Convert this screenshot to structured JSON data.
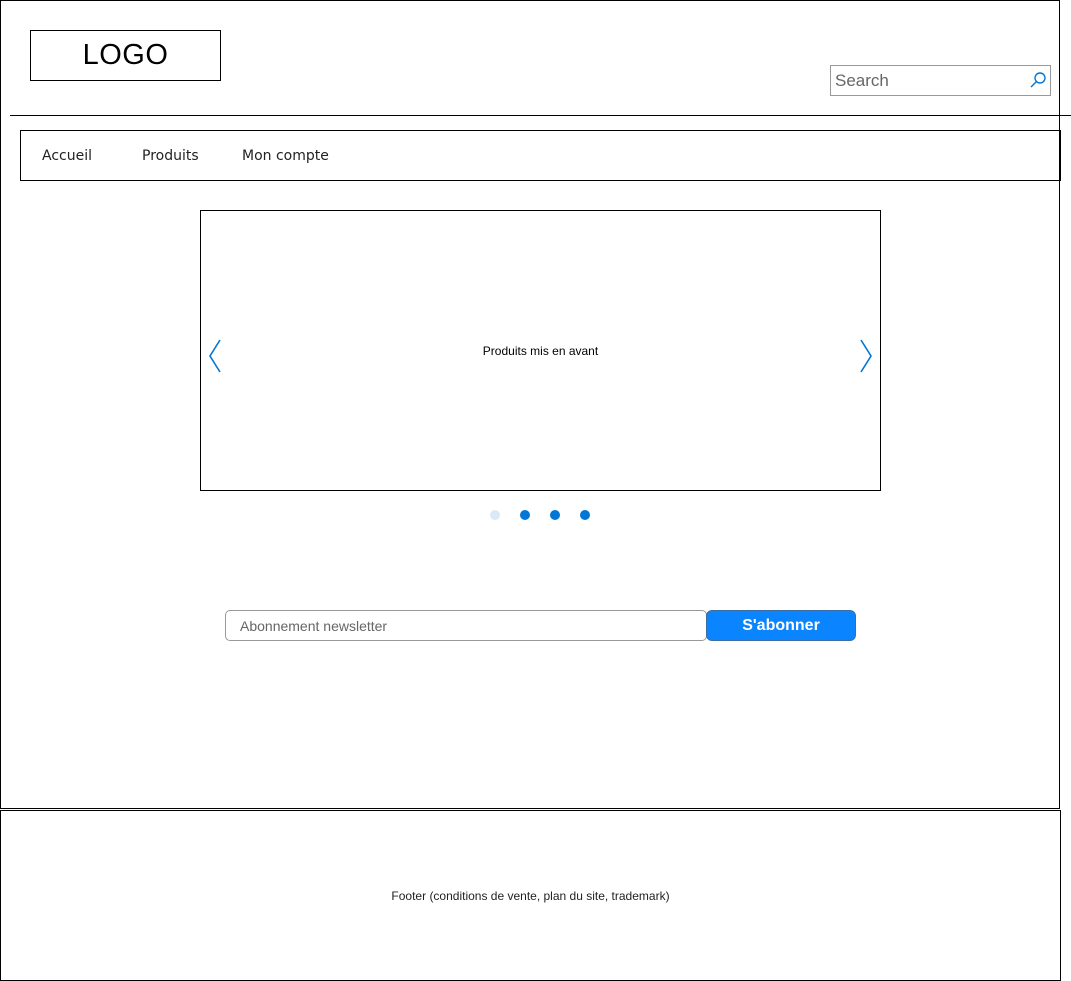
{
  "header": {
    "logo_text": "LOGO",
    "search_placeholder": "Search"
  },
  "nav": {
    "items": [
      {
        "label": "Accueil"
      },
      {
        "label": "Produits"
      },
      {
        "label": "Mon compte"
      }
    ]
  },
  "carousel": {
    "caption": "Produits mis en avant",
    "prev_icon": "chevron-left-icon",
    "next_icon": "chevron-right-icon",
    "slide_count": 4,
    "active_index": 0
  },
  "newsletter": {
    "placeholder": "Abonnement newsletter",
    "button_label": "S'abonner"
  },
  "footer": {
    "text": "Footer (conditions de vente, plan du site, trademark)"
  },
  "colors": {
    "accent": "#0a84ff",
    "icon_blue": "#0077d6",
    "dot_active": "#dbe9f7",
    "dot_inactive": "#0077d6"
  }
}
